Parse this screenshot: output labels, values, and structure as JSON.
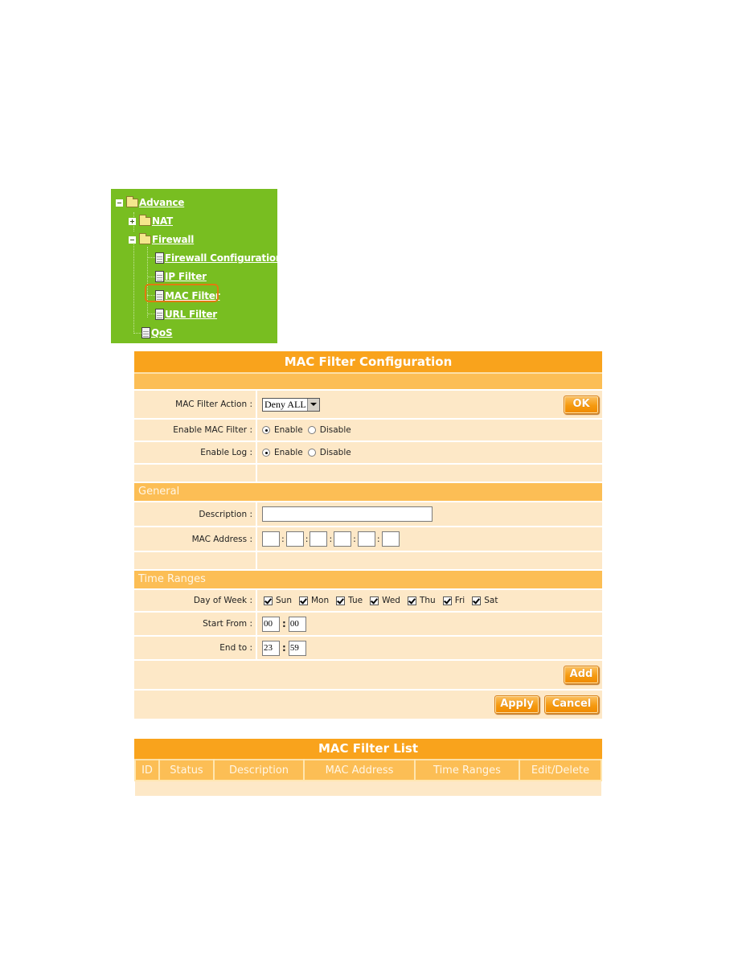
{
  "tree": {
    "items": [
      {
        "label": "Advance",
        "type": "folder",
        "toggle": "minus"
      },
      {
        "label": "NAT",
        "type": "folder",
        "toggle": "plus"
      },
      {
        "label": "Firewall",
        "type": "folder",
        "toggle": "minus"
      },
      {
        "label": "Firewall Configuration",
        "type": "page"
      },
      {
        "label": "IP Filter",
        "type": "page"
      },
      {
        "label": "MAC Filter",
        "type": "page",
        "highlighted": true
      },
      {
        "label": "URL Filter",
        "type": "page"
      },
      {
        "label": "QoS",
        "type": "page"
      }
    ]
  },
  "config": {
    "title": "MAC Filter Configuration",
    "action": {
      "label": "MAC Filter Action :",
      "selected": "Deny ALL",
      "ok_label": "OK"
    },
    "enable_filter": {
      "label": "Enable MAC Filter :",
      "options": [
        "Enable",
        "Disable"
      ],
      "selected": "Enable"
    },
    "enable_log": {
      "label": "Enable Log :",
      "options": [
        "Enable",
        "Disable"
      ],
      "selected": "Enable"
    },
    "general": {
      "section_title": "General",
      "description": {
        "label": "Description :",
        "value": ""
      },
      "mac_address": {
        "label": "MAC Address :",
        "octets": [
          "",
          "",
          "",
          "",
          "",
          ""
        ],
        "separator": ":"
      }
    },
    "time_ranges": {
      "section_title": "Time Ranges",
      "day_of_week": {
        "label": "Day of Week :",
        "days": [
          {
            "label": "Sun",
            "checked": true
          },
          {
            "label": "Mon",
            "checked": true
          },
          {
            "label": "Tue",
            "checked": true
          },
          {
            "label": "Wed",
            "checked": true
          },
          {
            "label": "Thu",
            "checked": true
          },
          {
            "label": "Fri",
            "checked": true
          },
          {
            "label": "Sat",
            "checked": true
          }
        ]
      },
      "start_from": {
        "label": "Start From :",
        "hour": "00",
        "minute": "00"
      },
      "end_to": {
        "label": "End to :",
        "hour": "23",
        "minute": "59"
      },
      "time_separator": ":"
    },
    "buttons": {
      "add": "Add",
      "apply": "Apply",
      "cancel": "Cancel"
    }
  },
  "list": {
    "title": "MAC Filter List",
    "columns": [
      "ID",
      "Status",
      "Description",
      "MAC Address",
      "Time Ranges",
      "Edit/Delete"
    ],
    "rows": []
  },
  "colors": {
    "tree_bg": "#78be21",
    "header_orange": "#f9a31c",
    "section_orange": "#fcbe55",
    "row_bg": "#fde8c7",
    "highlight_border": "#e07a10"
  }
}
